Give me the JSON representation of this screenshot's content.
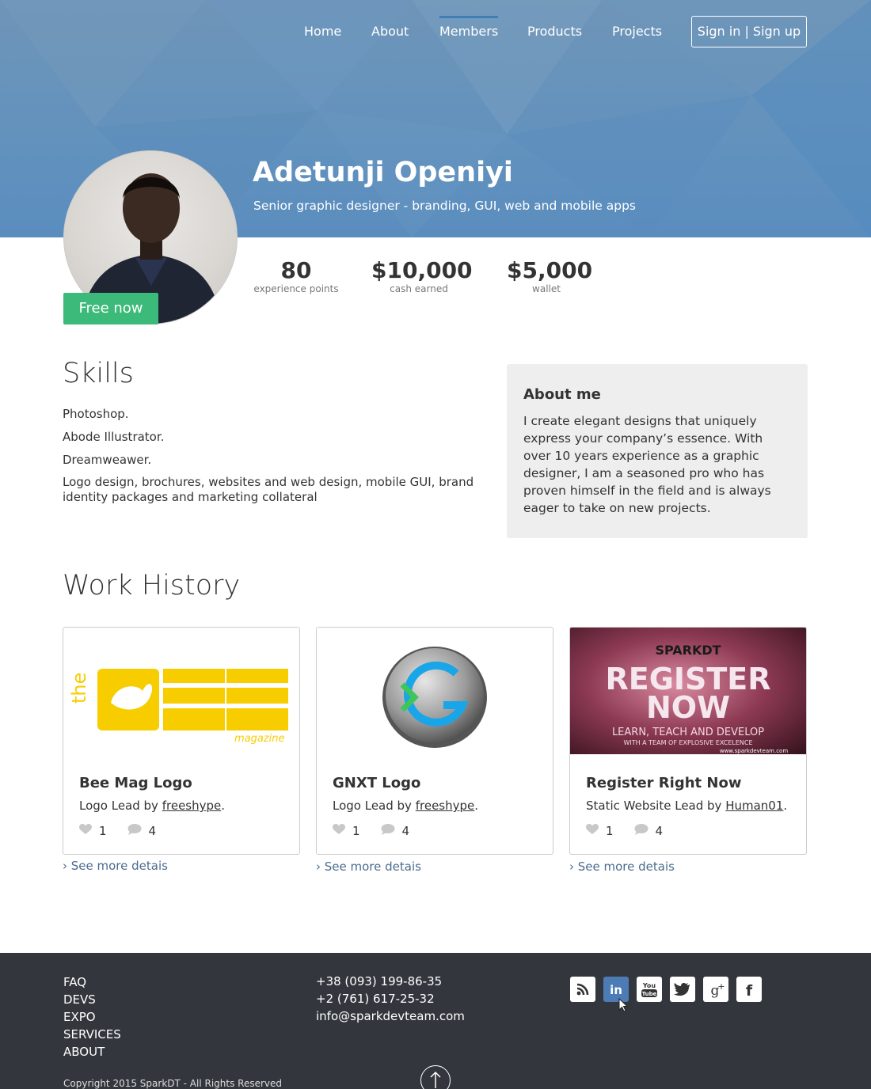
{
  "nav": {
    "items": [
      "Home",
      "About",
      "Members",
      "Products",
      "Projects"
    ],
    "active": "Members",
    "signin_label": "Sign in | Sign up"
  },
  "profile": {
    "name": "Adetunji Openiyi",
    "role": "Senior graphic designer - branding, GUI, web and mobile apps",
    "status": "Free now",
    "stats": [
      {
        "value": "80",
        "label": "experience points"
      },
      {
        "value": "$10,000",
        "label": "cash earned"
      },
      {
        "value": "$5,000",
        "label": "wallet"
      }
    ]
  },
  "skills": {
    "title": "Skills",
    "items": [
      "Photoshop.",
      "Abode Illustrator.",
      "Dreamweawer.",
      "Logo design, brochures, websites and web design, mobile GUI, brand identity packages and marketing collateral"
    ]
  },
  "about": {
    "title": "About me",
    "text": "I create elegant designs that uniquely express your company’s essence. With over 10 years experience as a graphic designer, I am a seasoned pro who has proven himself in the field and is always eager to take on new projects."
  },
  "work": {
    "title": "Work History",
    "cards": [
      {
        "title": "Bee Mag Logo",
        "lead_prefix": "Logo Lead by ",
        "lead_user": "freeshype",
        "lead_suffix": ".",
        "likes": "1",
        "comments": "4",
        "thumb_word": "the",
        "thumb_sub": "magazine"
      },
      {
        "title": "GNXT Logo",
        "lead_prefix": "Logo Lead by ",
        "lead_user": "freeshype",
        "lead_suffix": ".",
        "likes": "1",
        "comments": "4"
      },
      {
        "title": "Register Right Now",
        "lead_prefix": "Static Website Lead by ",
        "lead_user": "Human01",
        "lead_suffix": ".",
        "likes": "1",
        "comments": "4",
        "thumb_brand": "SPARKDT",
        "thumb_line1": "REGISTER",
        "thumb_line2": "NOW",
        "thumb_tagline": "LEARN, TEACH AND DEVELOP",
        "thumb_tag2": "WITH A TEAM OF EXPLOSIVE EXCELENCE",
        "thumb_url": "www.sparkdevteam.com"
      }
    ],
    "see_more": "› See more detais"
  },
  "footer": {
    "links": [
      "FAQ",
      "DEVS",
      "EXPO",
      "SERVICES",
      "ABOUT"
    ],
    "phone1": "+38 (093) 199-86-35",
    "phone2": "+2 (761) 617-25-32",
    "email": "info@sparkdevteam.com",
    "social": [
      "rss-icon",
      "linkedin-icon",
      "youtube-icon",
      "twitter-icon",
      "google-plus-icon",
      "facebook-icon"
    ],
    "copyright": "Copyright 2015 SparkDT - All Rights Reserved"
  },
  "colors": {
    "hero": "#6392bd",
    "accent": "#3cba79",
    "nav_active": "#3f7fb6",
    "footer": "#33373d",
    "link": "#4a6c8f"
  }
}
